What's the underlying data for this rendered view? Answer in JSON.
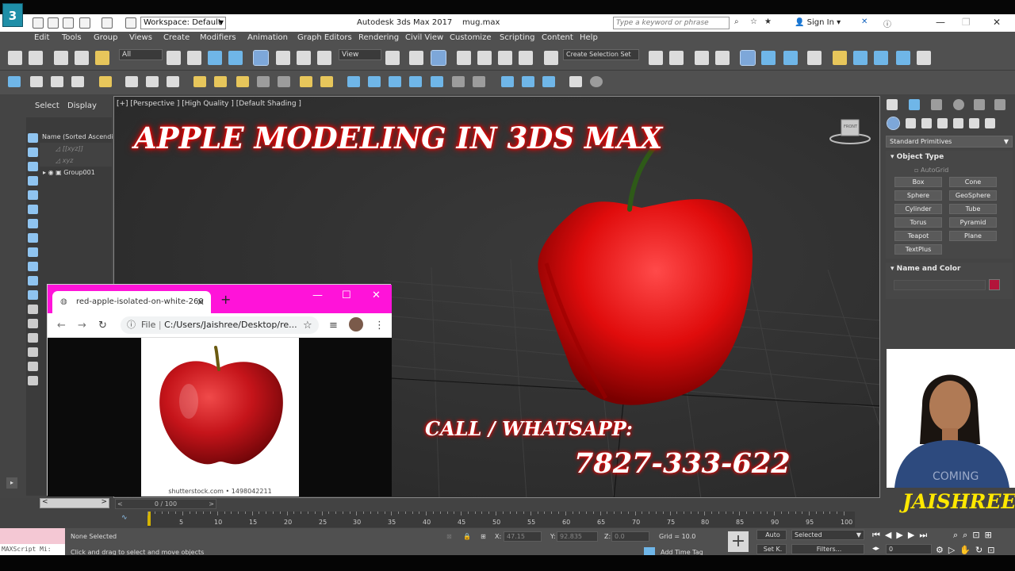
{
  "app": {
    "logo_text": "3",
    "title": "Autodesk 3ds Max 2017",
    "file": "mug.max",
    "workspace": "Workspace: Default",
    "search_placeholder": "Type a keyword or phrase",
    "sign_in": "Sign In"
  },
  "menu": [
    "Edit",
    "Tools",
    "Group",
    "Views",
    "Create",
    "Modifiers",
    "Animation",
    "Graph Editors",
    "Rendering",
    "Civil View",
    "Customize",
    "Scripting",
    "Content",
    "Help"
  ],
  "toolbar": {
    "selection_filter": "All",
    "ref_coord": "View",
    "selection_set": "Create Selection Set"
  },
  "scene_explorer": {
    "tabs": [
      "Select",
      "Display"
    ],
    "column_header": "Name (Sorted Ascendi",
    "items": [
      "[[xyz]]",
      "xyz",
      "Group001"
    ]
  },
  "viewport": {
    "label": "[+] [Perspective ] [High Quality ] [Default Shading ]",
    "overlay_title": "APPLE MODELING IN 3DS MAX",
    "call_text": "CALL / WHATSAPP:",
    "phone": "7827-333-622",
    "viewcube_label": "FRONT"
  },
  "browser": {
    "tab_title": "red-apple-isolated-on-white-260",
    "file_label": "File",
    "url": "C:/Users/Jaishree/Desktop/re...",
    "image_credit": "shutterstock.com • 1498042211"
  },
  "command_panel": {
    "category": "Standard Primitives",
    "object_type_header": "Object Type",
    "autogrid": "AutoGrid",
    "buttons": [
      "Box",
      "Cone",
      "Sphere",
      "GeoSphere",
      "Cylinder",
      "Tube",
      "Torus",
      "Pyramid",
      "Teapot",
      "Plane",
      "TextPlus"
    ],
    "name_color_header": "Name and Color",
    "color": "#b3143a"
  },
  "presenter": {
    "name": "JAISHREE",
    "shirt_text": "COMING"
  },
  "timeline": {
    "range": "0 / 100",
    "ticks": [
      "5",
      "10",
      "15",
      "20",
      "25",
      "30",
      "35",
      "40",
      "45",
      "50",
      "55",
      "60",
      "65",
      "70",
      "75",
      "80",
      "85",
      "90",
      "95",
      "100"
    ]
  },
  "status": {
    "selection": "None Selected",
    "prompt": "Click and drag to select and move objects",
    "maxscript": "MAXScript Mi:",
    "x_label": "X:",
    "x_val": "47.15",
    "y_label": "Y:",
    "y_val": "92.835",
    "z_label": "Z:",
    "z_val": "0.0",
    "grid": "Grid = 10.0",
    "add_time_tag": "Add Time Tag",
    "auto": "Auto",
    "set_key": "Set K.",
    "selected": "Selected",
    "filters": "Filters...",
    "frame": "0"
  },
  "colors": {
    "ui_bg": "#505050",
    "accent": "#6fb6e8",
    "overlay_glow": "#ff0000",
    "browser_frame": "#ff13d9",
    "name_yellow": "#ffe800"
  }
}
